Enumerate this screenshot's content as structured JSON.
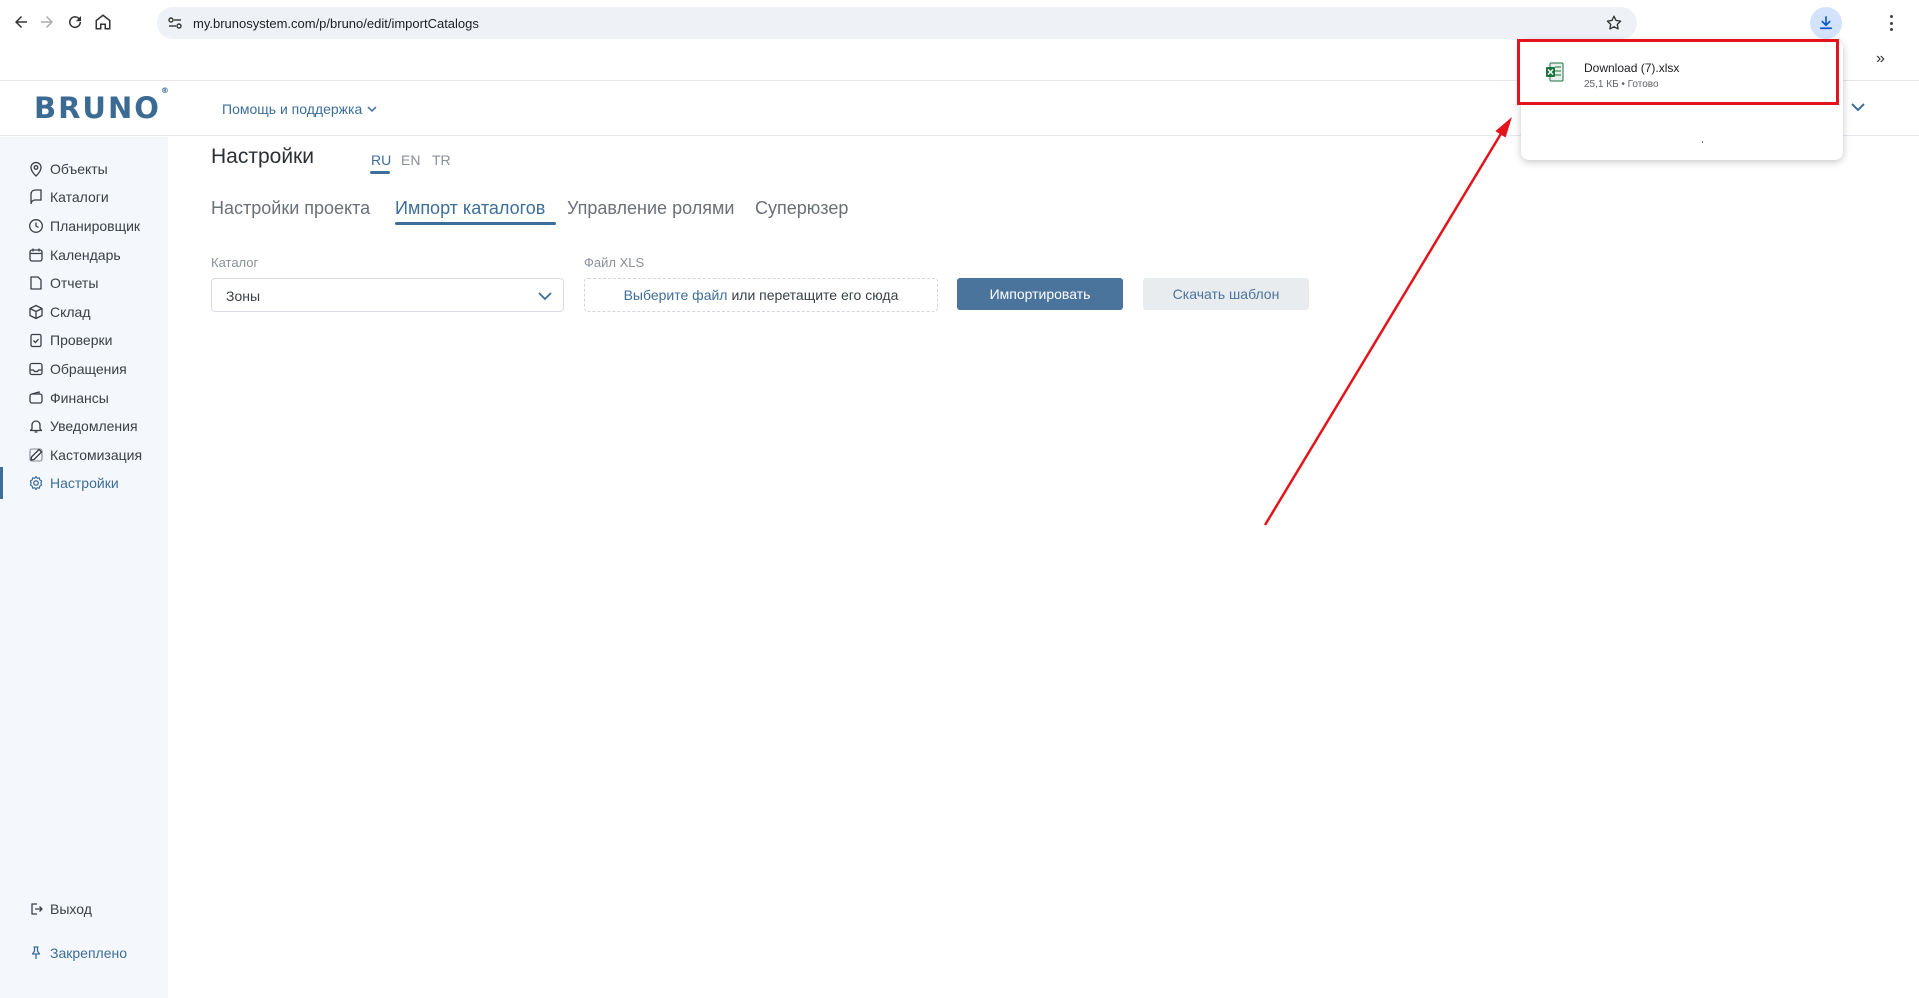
{
  "browser": {
    "url": "my.brunosystem.com/p/bruno/edit/importCatalogs",
    "back_icon": "arrow-left-icon",
    "forward_icon": "arrow-right-icon",
    "reload_icon": "reload-icon",
    "home_icon": "home-icon"
  },
  "header": {
    "logo": "BRUNO",
    "logo_mark": "®",
    "help_menu": "Помощь и поддержка"
  },
  "sidebar": {
    "items": [
      {
        "label": "Объекты",
        "icon": "map-pin-icon"
      },
      {
        "label": "Каталоги",
        "icon": "catalog-icon"
      },
      {
        "label": "Планировщик",
        "icon": "clock-icon"
      },
      {
        "label": "Календарь",
        "icon": "calendar-icon"
      },
      {
        "label": "Отчеты",
        "icon": "report-icon"
      },
      {
        "label": "Склад",
        "icon": "box-icon"
      },
      {
        "label": "Проверки",
        "icon": "checklist-icon"
      },
      {
        "label": "Обращения",
        "icon": "inbox-icon"
      },
      {
        "label": "Финансы",
        "icon": "wallet-icon"
      },
      {
        "label": "Уведомления",
        "icon": "bell-icon"
      },
      {
        "label": "Кастомизация",
        "icon": "pencil-icon"
      },
      {
        "label": "Настройки",
        "icon": "gear-icon",
        "active": true
      }
    ],
    "logout": "Выход",
    "pinned": "Закреплено"
  },
  "page": {
    "title": "Настройки",
    "languages": [
      "RU",
      "EN",
      "TR"
    ],
    "active_language": "RU",
    "tabs": [
      "Настройки проекта",
      "Импорт каталогов",
      "Управление ролями",
      "Суперюзер"
    ],
    "active_tab": "Импорт каталогов"
  },
  "form": {
    "catalog_label": "Каталог",
    "catalog_value": "Зоны",
    "file_label": "Файл XLS",
    "file_link": "Выберите файл",
    "file_hint": "или перетащите его сюда",
    "import_button": "Импортировать",
    "template_button": "Скачать шаблон"
  },
  "download_popup": {
    "file_name": "Download (7).xlsx",
    "meta": "25,1 КБ • Готово",
    "file_icon": "excel-file-icon"
  },
  "colors": {
    "brand": "#3d6e9a",
    "primary_button": "#4a749c",
    "highlight": "#e3141b",
    "sidebar_bg": "#f4f7fb"
  }
}
